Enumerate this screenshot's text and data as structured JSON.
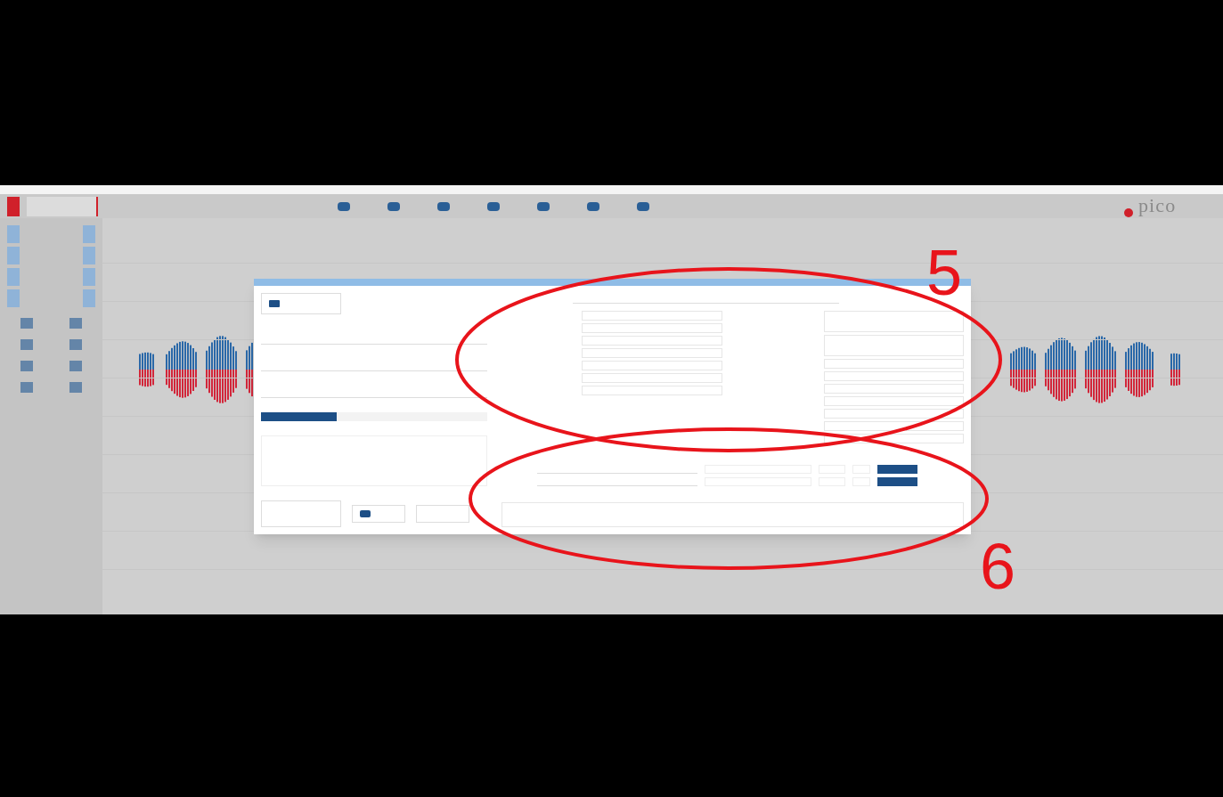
{
  "logo": {
    "text": "pico"
  },
  "record_indicator": {
    "on": true
  },
  "dialog": {
    "segments": [
      {
        "selected": true
      },
      {
        "selected": false
      },
      {
        "selected": false
      }
    ]
  },
  "annotations": [
    {
      "label": "5"
    },
    {
      "label": "6"
    }
  ]
}
